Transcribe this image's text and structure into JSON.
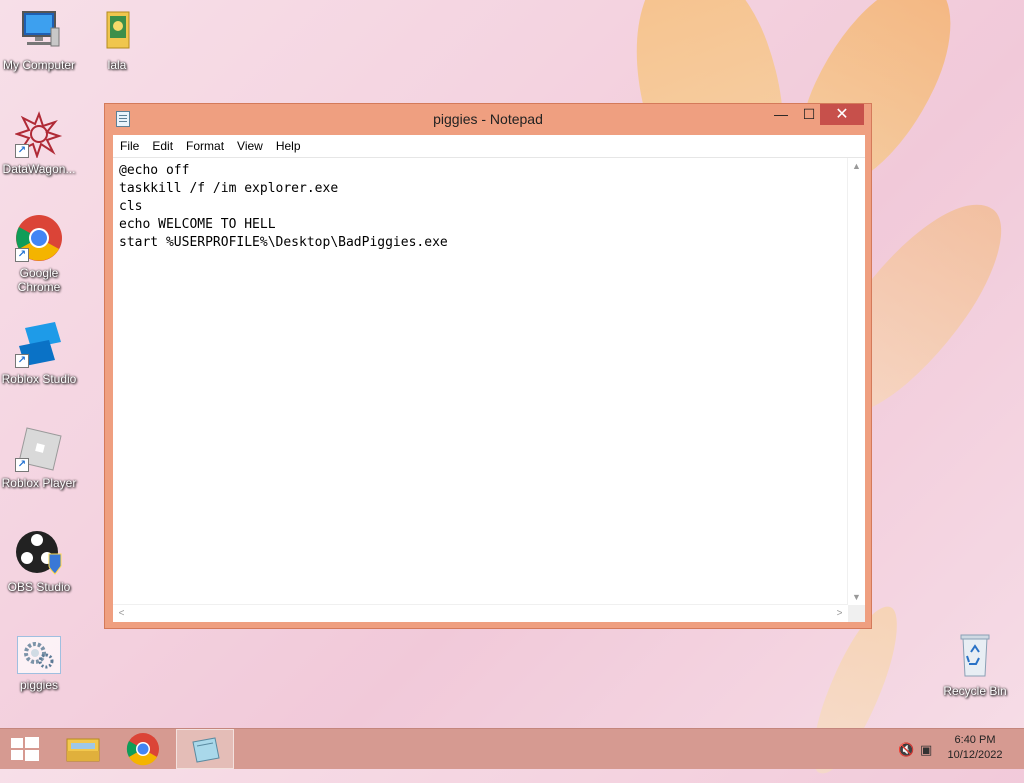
{
  "desktop": {
    "icons": [
      {
        "label": "My Computer"
      },
      {
        "label": "lala"
      },
      {
        "label": "DataWagon..."
      },
      {
        "label": "Google Chrome"
      },
      {
        "label": "Roblox Studio"
      },
      {
        "label": "Roblox Player"
      },
      {
        "label": "OBS Studio"
      },
      {
        "label": "piggies"
      },
      {
        "label": "Recycle Bin"
      }
    ]
  },
  "notepad": {
    "title": "piggies - Notepad",
    "controls": {
      "minimize": "—",
      "maximize": "☐",
      "close": "✕"
    },
    "menu": [
      "File",
      "Edit",
      "Format",
      "View",
      "Help"
    ],
    "content": "@echo off\ntaskkill /f /im explorer.exe\ncls\necho WELCOME TO HELL\nstart %USERPROFILE%\\Desktop\\BadPiggies.exe"
  },
  "taskbar": {
    "items": [
      "start-button",
      "file-explorer",
      "google-chrome",
      "notepad"
    ],
    "clock": {
      "time": "6:40 PM",
      "date": "10/12/2022"
    }
  },
  "colors": {
    "window_frame": "#ef9f80",
    "close_button": "#c7504b",
    "taskbar": "#d69a91"
  }
}
